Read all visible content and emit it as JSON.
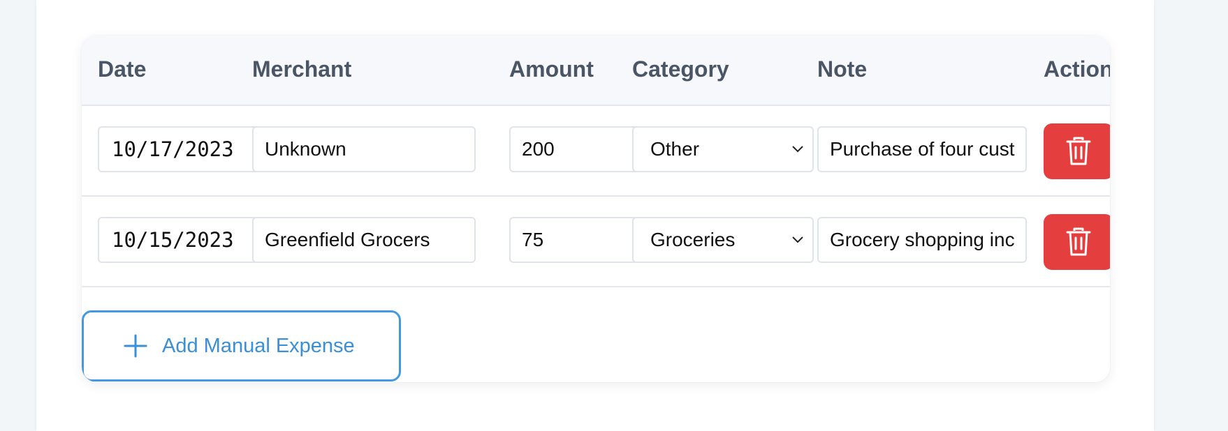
{
  "colors": {
    "header_text": "#4a5566",
    "delete_button": "#e53e3e",
    "accent_blue": "#4299e1"
  },
  "table": {
    "headers": {
      "date": "Date",
      "merchant": "Merchant",
      "amount": "Amount",
      "category": "Category",
      "note": "Note",
      "actions": "Actions"
    },
    "rows": [
      {
        "date": "10/17/2023",
        "merchant": "Unknown",
        "amount": "200",
        "category": "Other",
        "note": "Purchase of four cust",
        "delete_icon": "trash-icon"
      },
      {
        "date": "10/15/2023",
        "merchant": "Greenfield Grocers",
        "amount": "75",
        "category": "Groceries",
        "note": "Grocery shopping inc",
        "delete_icon": "trash-icon"
      }
    ]
  },
  "add_button": {
    "label": "Add Manual Expense",
    "icon": "plus-icon"
  }
}
